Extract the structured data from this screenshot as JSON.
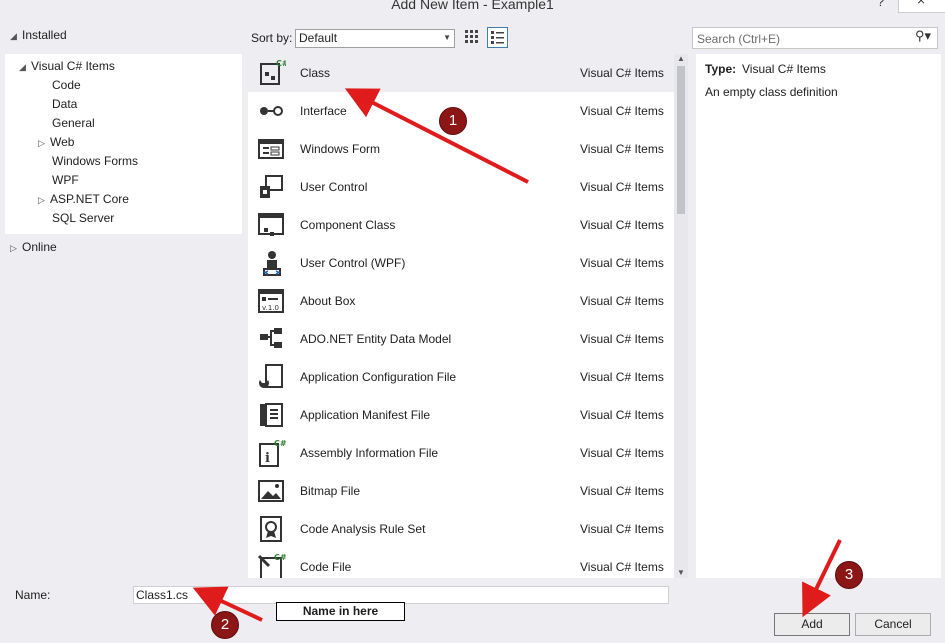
{
  "window": {
    "title": "Add New Item - Example1",
    "help": "?",
    "close": "×"
  },
  "tree": {
    "installed": "Installed",
    "visual_cs": "Visual C# Items",
    "children": [
      "Code",
      "Data",
      "General",
      "Web",
      "Windows Forms",
      "WPF",
      "ASP.NET Core",
      "SQL Server"
    ],
    "online": "Online"
  },
  "sort": {
    "label": "Sort by:",
    "value": "Default"
  },
  "search": {
    "placeholder": "Search (Ctrl+E)"
  },
  "items": [
    {
      "name": "Class",
      "category": "Visual C# Items",
      "icon": "class-icon"
    },
    {
      "name": "Interface",
      "category": "Visual C# Items",
      "icon": "interface-icon"
    },
    {
      "name": "Windows Form",
      "category": "Visual C# Items",
      "icon": "windows-form-icon"
    },
    {
      "name": "User Control",
      "category": "Visual C# Items",
      "icon": "user-control-icon"
    },
    {
      "name": "Component Class",
      "category": "Visual C# Items",
      "icon": "component-class-icon"
    },
    {
      "name": "User Control (WPF)",
      "category": "Visual C# Items",
      "icon": "user-control-wpf-icon"
    },
    {
      "name": "About Box",
      "category": "Visual C# Items",
      "icon": "about-box-icon"
    },
    {
      "name": "ADO.NET Entity Data Model",
      "category": "Visual C# Items",
      "icon": "entity-model-icon"
    },
    {
      "name": "Application Configuration File",
      "category": "Visual C# Items",
      "icon": "config-file-icon"
    },
    {
      "name": "Application Manifest File",
      "category": "Visual C# Items",
      "icon": "manifest-file-icon"
    },
    {
      "name": "Assembly Information File",
      "category": "Visual C# Items",
      "icon": "assembly-info-icon"
    },
    {
      "name": "Bitmap File",
      "category": "Visual C# Items",
      "icon": "bitmap-file-icon"
    },
    {
      "name": "Code Analysis Rule Set",
      "category": "Visual C# Items",
      "icon": "rule-set-icon"
    },
    {
      "name": "Code File",
      "category": "Visual C# Items",
      "icon": "code-file-icon"
    }
  ],
  "details": {
    "type_label": "Type:",
    "type_value": "Visual C# Items",
    "description": "An empty class definition"
  },
  "name": {
    "label": "Name:",
    "value": "Class1.cs"
  },
  "buttons": {
    "add": "Add",
    "cancel": "Cancel"
  },
  "annotations": {
    "badge1": "1",
    "badge2": "2",
    "badge3": "3",
    "note": "Name in here"
  },
  "colors": {
    "arrow": "#e01b1b",
    "badge": "#8c1616",
    "selection": "#eeeef2"
  }
}
